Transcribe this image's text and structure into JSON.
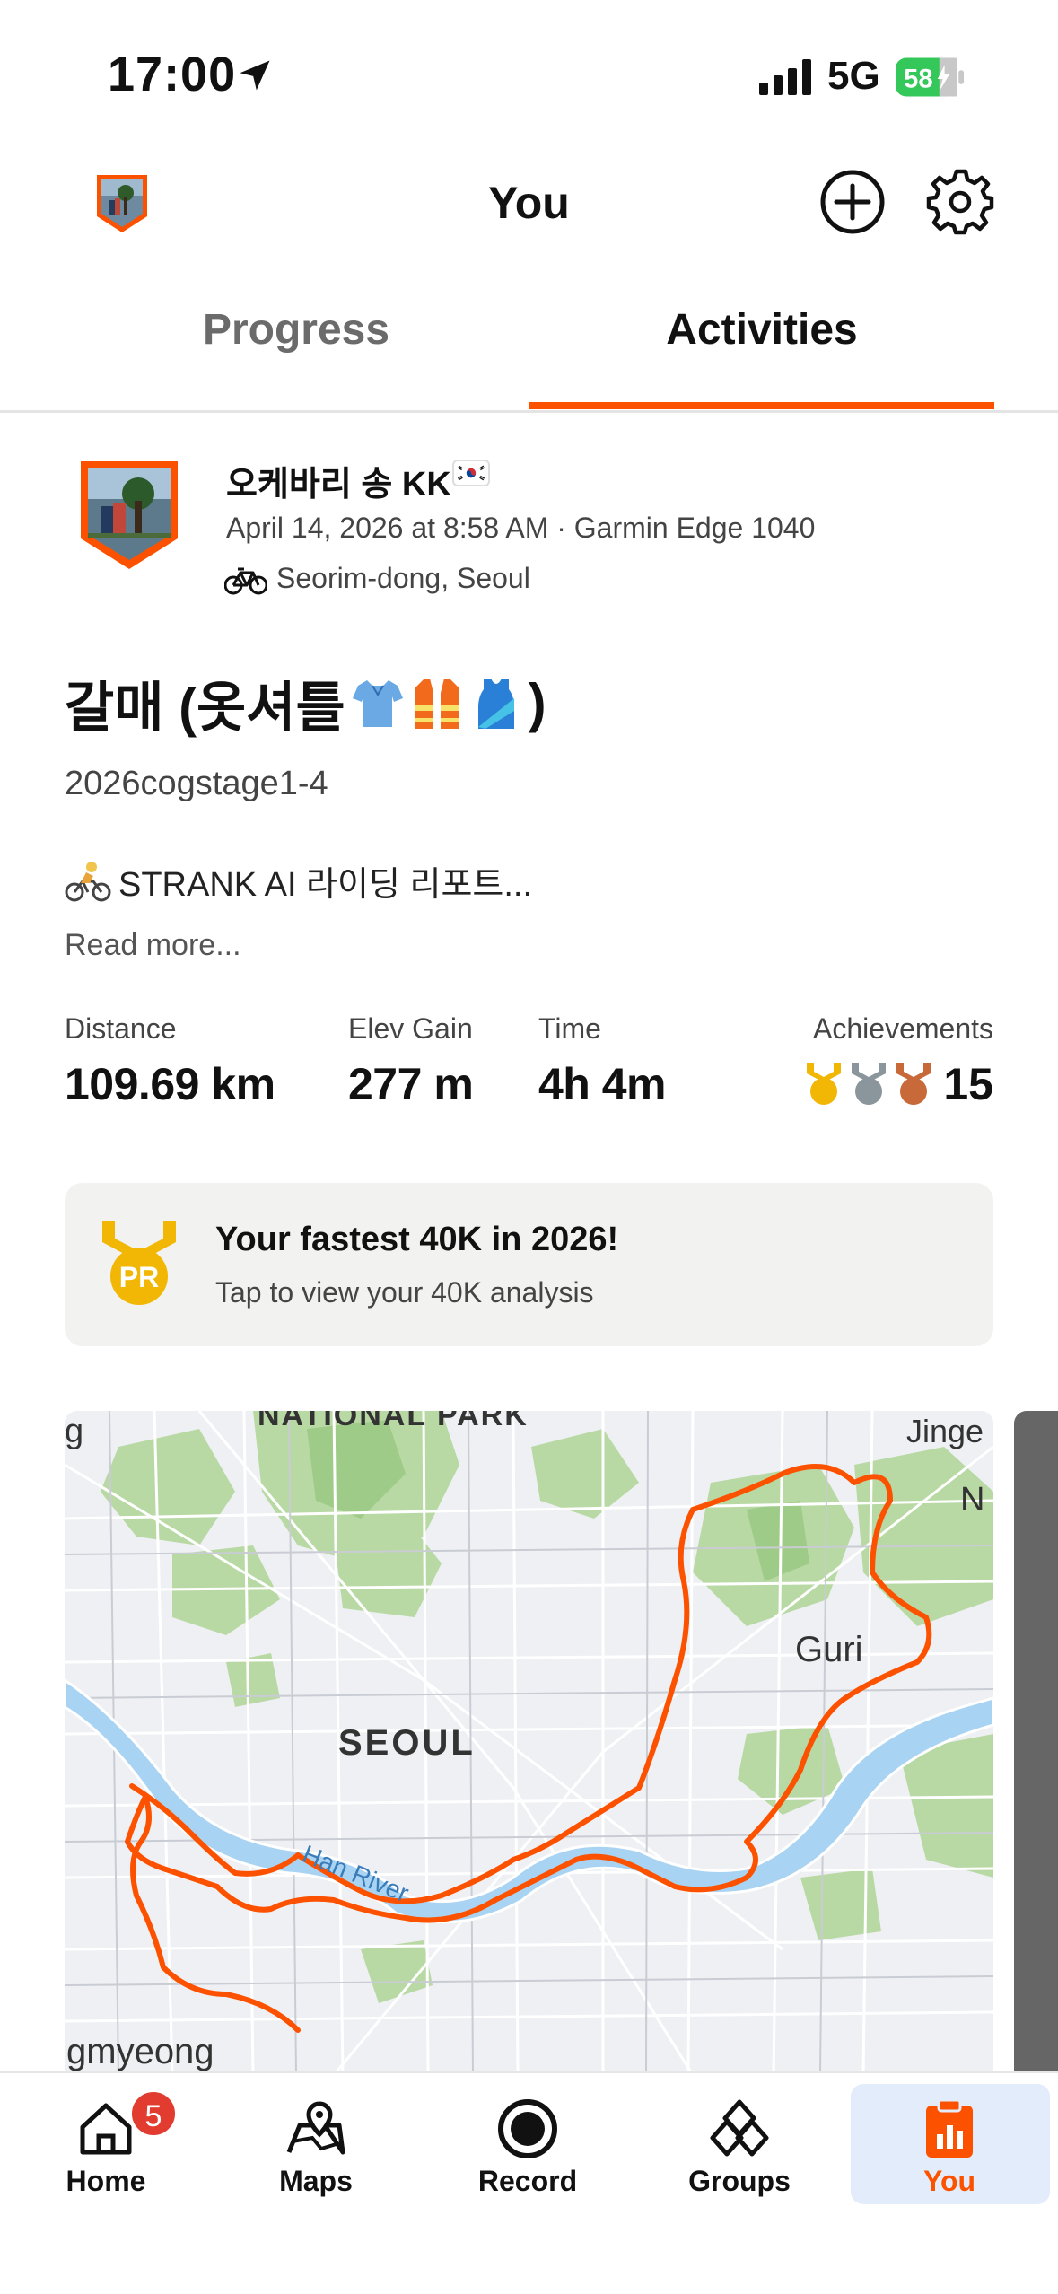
{
  "status_bar": {
    "time": "17:00",
    "network": "5G",
    "battery": "58"
  },
  "header": {
    "title": "You"
  },
  "tabs": [
    {
      "label": "Progress"
    },
    {
      "label": "Activities"
    }
  ],
  "activity": {
    "athlete_name": "오케바리 송 KK",
    "meta": "April 14, 2026 at 8:58 AM · Garmin Edge 1040",
    "location": "Seorim-dong, Seoul",
    "title": "갈매 (옷셔틀",
    "title_end": ")",
    "subtitle": "2026cogstage1-4",
    "description": "STRANK AI 라이딩 리포트...",
    "read_more": "Read more..."
  },
  "stats": {
    "distance_label": "Distance",
    "distance_value": "109.69 km",
    "elev_label": "Elev Gain",
    "elev_value": "277 m",
    "time_label": "Time",
    "time_value": "4h 4m",
    "achievements_label": "Achievements",
    "achievements_value": "15"
  },
  "pr_card": {
    "badge": "PR",
    "title": "Your fastest 40K in 2026!",
    "subtitle": "Tap to view your 40K analysis"
  },
  "map": {
    "labels": {
      "national_park": "NATIONAL PARK",
      "jinge": "Jinge",
      "n": "N",
      "guri": "Guri",
      "seoul": "SEOUL",
      "han_river": "Han River",
      "gmyeong": "gmyeong",
      "g": "g"
    },
    "route_color": "#fc5200"
  },
  "tabbar": {
    "items": [
      {
        "label": "Home"
      },
      {
        "label": "Maps"
      },
      {
        "label": "Record"
      },
      {
        "label": "Groups"
      },
      {
        "label": "You"
      }
    ],
    "home_badge": "5"
  },
  "colors": {
    "accent": "#fc5200",
    "battery_green": "#34c759",
    "you_tab_bg": "#e3ecfb"
  }
}
